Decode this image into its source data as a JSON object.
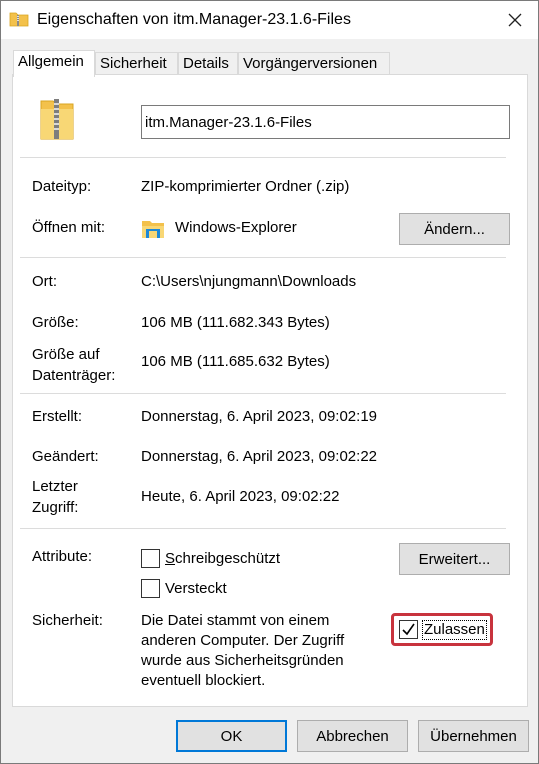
{
  "window": {
    "title": "Eigenschaften von itm.Manager-23.1.6-Files",
    "close_glyph": "✕"
  },
  "tabs": [
    {
      "label": "Allgemein",
      "active": true
    },
    {
      "label": "Sicherheit",
      "active": false
    },
    {
      "label": "Details",
      "active": false
    },
    {
      "label": "Vorgängerversionen",
      "active": false
    }
  ],
  "general": {
    "name_value": "itm.Manager-23.1.6-Files",
    "dateityp_label": "Dateityp:",
    "dateityp_value": "ZIP-komprimierter Ordner (.zip)",
    "oeffnen_label": "Öffnen mit:",
    "oeffnen_value": "Windows-Explorer",
    "aendern_button": "Ändern...",
    "ort_label": "Ort:",
    "ort_value": "C:\\Users\\njungmann\\Downloads",
    "groesse_label": "Größe:",
    "groesse_value": "106 MB (111.682.343 Bytes)",
    "groesse_auf_label_1": "Größe auf",
    "groesse_auf_label_2": "Datenträger:",
    "groesse_auf_value": "106 MB (111.685.632 Bytes)",
    "erstellt_label": "Erstellt:",
    "erstellt_value": "Donnerstag, 6. April 2023, 09:02:19",
    "geaendert_label": "Geändert:",
    "geaendert_value": "Donnerstag, 6. April 2023, 09:02:22",
    "zugriff_label_1": "Letzter",
    "zugriff_label_2": "Zugriff:",
    "zugriff_value": "Heute, 6. April 2023, 09:02:22",
    "attribute_label": "Attribute:",
    "readonly_label": "Schreibgeschützt",
    "readonly_checked": false,
    "hidden_label": "Versteckt",
    "hidden_checked": false,
    "erweitert_button": "Erweitert...",
    "sicherheit_label": "Sicherheit:",
    "security_line_1": "Die Datei stammt von einem",
    "security_line_2": "anderen Computer. Der Zugriff",
    "security_line_3": "wurde aus Sicherheitsgründen",
    "security_line_4": "eventuell blockiert.",
    "zulassen_label": "Zulassen",
    "zulassen_checked": true,
    "highlight_color": "#c8333d"
  },
  "footer": {
    "ok": "OK",
    "abbrechen": "Abbrechen",
    "uebernehmen": "Übernehmen"
  }
}
